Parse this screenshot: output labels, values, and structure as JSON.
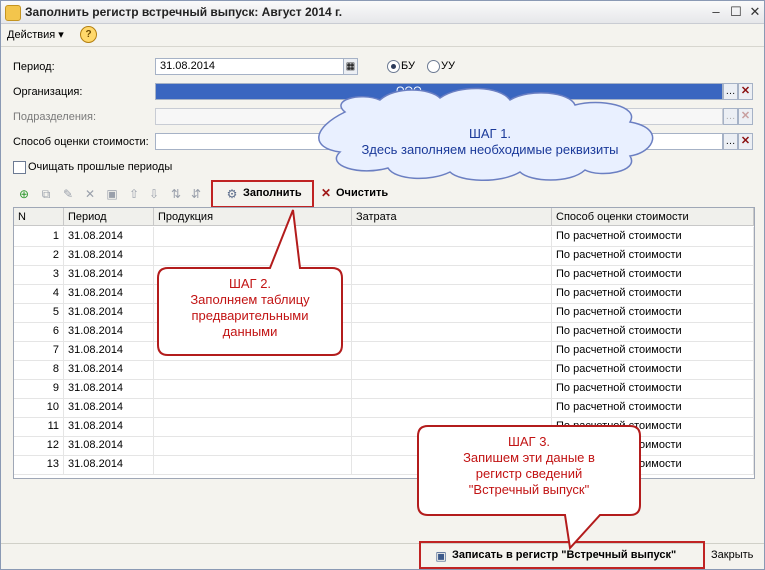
{
  "window": {
    "title": "Заполнить регистр встречный выпуск: Август 2014 г."
  },
  "menu": {
    "actions": "Действия",
    "help": "?"
  },
  "form": {
    "period_label": "Период:",
    "period_value": "31.08.2014",
    "radio_bu": "БУ",
    "radio_uu": "УУ",
    "org_label": "Организация:",
    "org_value": "ООО",
    "dept_label": "Подразделения:",
    "method_label": "Способ оценки стоимости:",
    "clear_past_label": "Очищать прошлые периоды"
  },
  "toolbar": {
    "fill": "Заполнить",
    "clear": "Очистить"
  },
  "grid": {
    "columns": [
      "N",
      "Период",
      "Продукция",
      "Затрата",
      "Способ оценки стоимости"
    ],
    "rows": [
      {
        "n": "1",
        "period": "31.08.2014",
        "method": "По расчетной стоимости"
      },
      {
        "n": "2",
        "period": "31.08.2014",
        "method": "По расчетной стоимости"
      },
      {
        "n": "3",
        "period": "31.08.2014",
        "method": "По расчетной стоимости"
      },
      {
        "n": "4",
        "period": "31.08.2014",
        "method": "По расчетной стоимости"
      },
      {
        "n": "5",
        "period": "31.08.2014",
        "method": "По расчетной стоимости"
      },
      {
        "n": "6",
        "period": "31.08.2014",
        "method": "По расчетной стоимости"
      },
      {
        "n": "7",
        "period": "31.08.2014",
        "method": "По расчетной стоимости"
      },
      {
        "n": "8",
        "period": "31.08.2014",
        "method": "По расчетной стоимости"
      },
      {
        "n": "9",
        "period": "31.08.2014",
        "method": "По расчетной стоимости"
      },
      {
        "n": "10",
        "period": "31.08.2014",
        "method": "По расчетной стоимости"
      },
      {
        "n": "11",
        "period": "31.08.2014",
        "method": "По расчетной стоимости"
      },
      {
        "n": "12",
        "period": "31.08.2014",
        "method": "По расчетной стоимости"
      },
      {
        "n": "13",
        "period": "31.08.2014",
        "method": "По расчетной стоимости"
      }
    ]
  },
  "footer": {
    "write": "Записать в регистр \"Встречный выпуск\"",
    "close": "Закрыть"
  },
  "callouts": {
    "step1_title": "ШАГ 1.",
    "step1_text": "Здесь заполняем необходимые реквизиты",
    "step2_title": "ШАГ 2.",
    "step2_line1": "Заполняем таблицу",
    "step2_line2": "предварительными",
    "step2_line3": "данными",
    "step3_title": "ШАГ 3.",
    "step3_line1": "Запишем эти даные в",
    "step3_line2": "регистр сведений",
    "step3_line3": "\"Встречный выпуск\""
  },
  "colors": {
    "highlight": "#c02323",
    "selection": "#3a66c0",
    "callout_red": "#c21414",
    "callout_blue": "#1b3a9a"
  }
}
